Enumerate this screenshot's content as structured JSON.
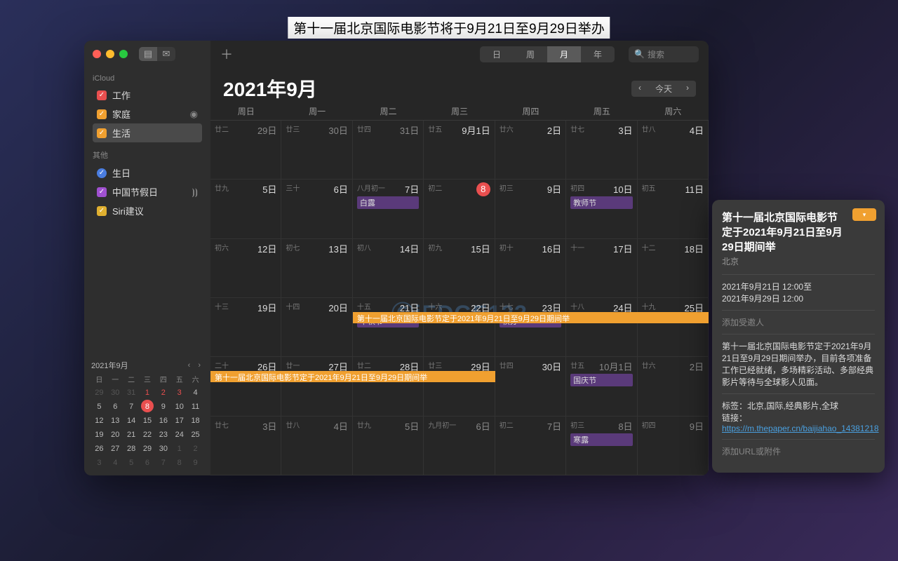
{
  "banner": "第十一届北京国际电影节将于9月21日至9月29日举办",
  "watermark": "ⒸiEDGE123",
  "sidebar": {
    "group1": "iCloud",
    "items1": [
      {
        "label": "工作",
        "color": "red"
      },
      {
        "label": "家庭",
        "color": "orange",
        "shared": true
      },
      {
        "label": "生活",
        "color": "orange",
        "selected": true
      }
    ],
    "group2": "其他",
    "items2": [
      {
        "label": "生日",
        "color": "blue"
      },
      {
        "label": "中国节假日",
        "color": "purple",
        "broadcast": true
      },
      {
        "label": "Siri建议",
        "color": "yellow"
      }
    ]
  },
  "toolbar": {
    "views": [
      "日",
      "周",
      "月",
      "年"
    ],
    "active": "月",
    "search_placeholder": "搜索"
  },
  "header": {
    "title": "2021年9月",
    "today": "今天"
  },
  "dow": [
    "周日",
    "周一",
    "周二",
    "周三",
    "周四",
    "周五",
    "周六"
  ],
  "mini": {
    "title": "2021年9月",
    "dh": [
      "日",
      "一",
      "二",
      "三",
      "四",
      "五",
      "六"
    ],
    "prev": [
      29,
      30,
      31
    ],
    "days": 30,
    "today": 8,
    "marks": [
      1,
      2,
      3
    ],
    "next": [
      1,
      2,
      3,
      4,
      5,
      6,
      7,
      8,
      9
    ]
  },
  "cells": [
    {
      "ln": "廿二",
      "dn": "29日"
    },
    {
      "ln": "廿三",
      "dn": "30日"
    },
    {
      "ln": "廿四",
      "dn": "31日"
    },
    {
      "ln": "廿五",
      "dn": "9月1日",
      "cur": true
    },
    {
      "ln": "廿六",
      "dn": "2日",
      "cur": true
    },
    {
      "ln": "廿七",
      "dn": "3日",
      "cur": true
    },
    {
      "ln": "廿八",
      "dn": "4日",
      "cur": true
    },
    {
      "ln": "廿九",
      "dn": "5日",
      "cur": true
    },
    {
      "ln": "三十",
      "dn": "6日",
      "cur": true
    },
    {
      "ln": "八月初一",
      "dn": "7日",
      "cur": true,
      "ev": [
        {
          "t": "白露",
          "c": "purple"
        }
      ]
    },
    {
      "ln": "初二",
      "dn": "8",
      "cur": true,
      "today": true
    },
    {
      "ln": "初三",
      "dn": "9日",
      "cur": true
    },
    {
      "ln": "初四",
      "dn": "10日",
      "cur": true,
      "ev": [
        {
          "t": "教师节",
          "c": "purple"
        }
      ]
    },
    {
      "ln": "初五",
      "dn": "11日",
      "cur": true
    },
    {
      "ln": "初六",
      "dn": "12日",
      "cur": true
    },
    {
      "ln": "初七",
      "dn": "13日",
      "cur": true
    },
    {
      "ln": "初八",
      "dn": "14日",
      "cur": true
    },
    {
      "ln": "初九",
      "dn": "15日",
      "cur": true
    },
    {
      "ln": "初十",
      "dn": "16日",
      "cur": true
    },
    {
      "ln": "十一",
      "dn": "17日",
      "cur": true
    },
    {
      "ln": "十二",
      "dn": "18日",
      "cur": true
    },
    {
      "ln": "十三",
      "dn": "19日",
      "cur": true
    },
    {
      "ln": "十四",
      "dn": "20日",
      "cur": true
    },
    {
      "ln": "十五",
      "dn": "21日",
      "cur": true,
      "ev": [
        {
          "t": "中秋节",
          "c": "purple"
        }
      ]
    },
    {
      "ln": "十六",
      "dn": "22日",
      "cur": true
    },
    {
      "ln": "十七",
      "dn": "23日",
      "cur": true,
      "ev": [
        {
          "t": "秋分",
          "c": "purple"
        }
      ]
    },
    {
      "ln": "十八",
      "dn": "24日",
      "cur": true
    },
    {
      "ln": "十九",
      "dn": "25日",
      "cur": true
    },
    {
      "ln": "二十",
      "dn": "26日",
      "cur": true
    },
    {
      "ln": "廿一",
      "dn": "27日",
      "cur": true
    },
    {
      "ln": "廿二",
      "dn": "28日",
      "cur": true
    },
    {
      "ln": "廿三",
      "dn": "29日",
      "cur": true
    },
    {
      "ln": "廿四",
      "dn": "30日",
      "cur": true
    },
    {
      "ln": "廿五",
      "dn": "10月1日",
      "ev": [
        {
          "t": "国庆节",
          "c": "purple"
        }
      ]
    },
    {
      "ln": "廿六",
      "dn": "2日"
    },
    {
      "ln": "廿七",
      "dn": "3日"
    },
    {
      "ln": "廿八",
      "dn": "4日"
    },
    {
      "ln": "廿九",
      "dn": "5日"
    },
    {
      "ln": "九月初一",
      "dn": "6日"
    },
    {
      "ln": "初二",
      "dn": "7日"
    },
    {
      "ln": "初三",
      "dn": "8日",
      "ev": [
        {
          "t": "寒露",
          "c": "purple"
        }
      ]
    },
    {
      "ln": "初四",
      "dn": "9日"
    }
  ],
  "span_event": "第十一届北京国际电影节定于2021年9月21日至9月29日期间举",
  "popover": {
    "title": "第十一届北京国际电影节定于2021年9月21日至9月29日期间举",
    "location": "北京",
    "time": "2021年9月21日 12:00至\n2021年9月29日 12:00",
    "invite": "添加受邀人",
    "desc": "第十一届北京国际电影节定于2021年9月21日至9月29日期间举办，目前各项准备工作已经就绪，多场精彩活动、多部经典影片等待与全球影人见面。",
    "tags_label": "标签：",
    "tags": "北京,国际,经典影片,全球",
    "link_label": "链接：",
    "link": "https://m.thepaper.cn/baijiahao_14381218",
    "attach": "添加URL或附件"
  }
}
